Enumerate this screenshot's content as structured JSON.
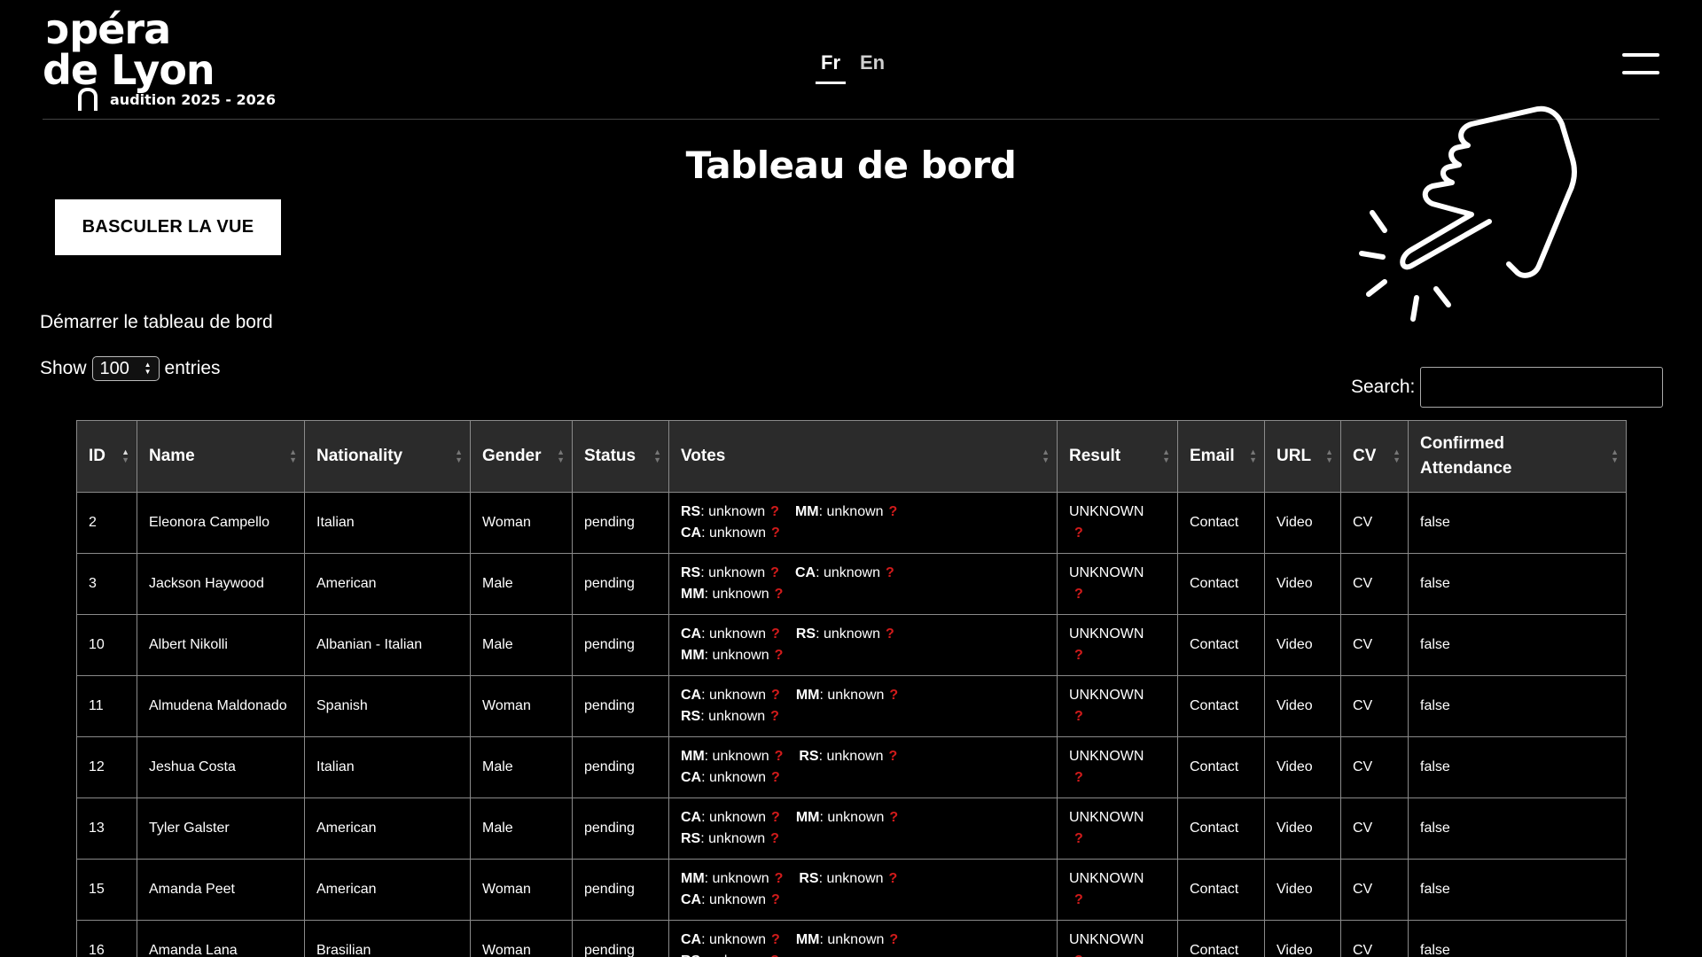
{
  "header": {
    "logo_line1": "ɔpéra",
    "logo_line2": "de Lyon",
    "season": "audition 2025 - 2026",
    "lang_fr": "Fr",
    "lang_en": "En"
  },
  "main": {
    "title": "Tableau de bord",
    "toggle_label": "BASCULER LA VUE",
    "start_text": "Démarrer le tableau de bord",
    "show_label": "Show",
    "entries_value": "100",
    "entries_label": "entries",
    "search_label": "Search:",
    "search_value": ""
  },
  "table": {
    "columns": [
      "ID",
      "Name",
      "Nationality",
      "Gender",
      "Status",
      "Votes",
      "Result",
      "Email",
      "URL",
      "CV",
      "Confirmed Attendance"
    ],
    "question_mark": "?",
    "rows": [
      {
        "id": "2",
        "name": "Eleonora Campello",
        "nationality": "Italian",
        "gender": "Woman",
        "status": "pending",
        "votes": [
          {
            "k": "RS",
            "v": "unknown"
          },
          {
            "k": "MM",
            "v": "unknown"
          },
          {
            "k": "CA",
            "v": "unknown"
          }
        ],
        "result": "UNKNOWN",
        "email": "Contact",
        "url": "Video",
        "cv": "CV",
        "confirmed": "false"
      },
      {
        "id": "3",
        "name": "Jackson Haywood",
        "nationality": "American",
        "gender": "Male",
        "status": "pending",
        "votes": [
          {
            "k": "RS",
            "v": "unknown"
          },
          {
            "k": "CA",
            "v": "unknown"
          },
          {
            "k": "MM",
            "v": "unknown"
          }
        ],
        "result": "UNKNOWN",
        "email": "Contact",
        "url": "Video",
        "cv": "CV",
        "confirmed": "false"
      },
      {
        "id": "10",
        "name": "Albert Nikolli",
        "nationality": "Albanian - Italian",
        "gender": "Male",
        "status": "pending",
        "votes": [
          {
            "k": "CA",
            "v": "unknown"
          },
          {
            "k": "RS",
            "v": "unknown"
          },
          {
            "k": "MM",
            "v": "unknown"
          }
        ],
        "result": "UNKNOWN",
        "email": "Contact",
        "url": "Video",
        "cv": "CV",
        "confirmed": "false"
      },
      {
        "id": "11",
        "name": "Almudena Maldonado",
        "nationality": "Spanish",
        "gender": "Woman",
        "status": "pending",
        "votes": [
          {
            "k": "CA",
            "v": "unknown"
          },
          {
            "k": "MM",
            "v": "unknown"
          },
          {
            "k": "RS",
            "v": "unknown"
          }
        ],
        "result": "UNKNOWN",
        "email": "Contact",
        "url": "Video",
        "cv": "CV",
        "confirmed": "false"
      },
      {
        "id": "12",
        "name": "Jeshua Costa",
        "nationality": "Italian",
        "gender": "Male",
        "status": "pending",
        "votes": [
          {
            "k": "MM",
            "v": "unknown"
          },
          {
            "k": "RS",
            "v": "unknown"
          },
          {
            "k": "CA",
            "v": "unknown"
          }
        ],
        "result": "UNKNOWN",
        "email": "Contact",
        "url": "Video",
        "cv": "CV",
        "confirmed": "false"
      },
      {
        "id": "13",
        "name": "Tyler Galster",
        "nationality": "American",
        "gender": "Male",
        "status": "pending",
        "votes": [
          {
            "k": "CA",
            "v": "unknown"
          },
          {
            "k": "MM",
            "v": "unknown"
          },
          {
            "k": "RS",
            "v": "unknown"
          }
        ],
        "result": "UNKNOWN",
        "email": "Contact",
        "url": "Video",
        "cv": "CV",
        "confirmed": "false"
      },
      {
        "id": "15",
        "name": "Amanda Peet",
        "nationality": "American",
        "gender": "Woman",
        "status": "pending",
        "votes": [
          {
            "k": "MM",
            "v": "unknown"
          },
          {
            "k": "RS",
            "v": "unknown"
          },
          {
            "k": "CA",
            "v": "unknown"
          }
        ],
        "result": "UNKNOWN",
        "email": "Contact",
        "url": "Video",
        "cv": "CV",
        "confirmed": "false"
      },
      {
        "id": "16",
        "name": "Amanda Lana",
        "nationality": "Brasilian",
        "gender": "Woman",
        "status": "pending",
        "votes": [
          {
            "k": "CA",
            "v": "unknown"
          },
          {
            "k": "MM",
            "v": "unknown"
          },
          {
            "k": "RS",
            "v": "unknown"
          }
        ],
        "result": "UNKNOWN",
        "email": "Contact",
        "url": "Video",
        "cv": "CV",
        "confirmed": "false"
      }
    ]
  },
  "colors": {
    "background": "#000000",
    "header_bg": "#2b2b2b",
    "accent_question": "#d21b1b"
  },
  "icons": {
    "menu": "hamburger-menu-icon",
    "hand": "pointing-hand-click-icon"
  }
}
